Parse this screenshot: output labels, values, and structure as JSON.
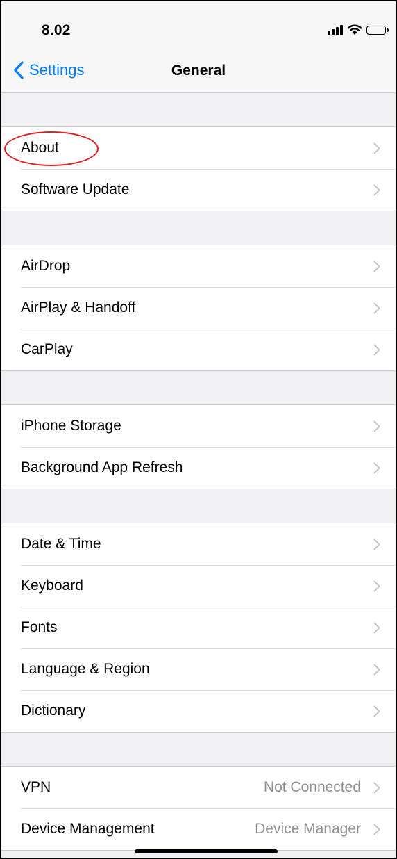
{
  "status_bar": {
    "time": "8.02"
  },
  "nav": {
    "back_label": "Settings",
    "title": "General"
  },
  "groups": [
    {
      "rows": [
        {
          "label": "About"
        },
        {
          "label": "Software Update"
        }
      ]
    },
    {
      "rows": [
        {
          "label": "AirDrop"
        },
        {
          "label": "AirPlay & Handoff"
        },
        {
          "label": "CarPlay"
        }
      ]
    },
    {
      "rows": [
        {
          "label": "iPhone Storage"
        },
        {
          "label": "Background App Refresh"
        }
      ]
    },
    {
      "rows": [
        {
          "label": "Date & Time"
        },
        {
          "label": "Keyboard"
        },
        {
          "label": "Fonts"
        },
        {
          "label": "Language & Region"
        },
        {
          "label": "Dictionary"
        }
      ]
    },
    {
      "rows": [
        {
          "label": "VPN",
          "detail": "Not Connected"
        },
        {
          "label": "Device Management",
          "detail": "Device Manager"
        }
      ]
    }
  ],
  "icons": {
    "back": "chevron-left-icon",
    "row": "chevron-right-icon",
    "signal": "cellular-signal-icon",
    "wifi": "wifi-icon",
    "battery": "battery-icon"
  },
  "colors": {
    "accent": "#007aff",
    "annotation": "#e02020",
    "background": "#efeff4",
    "detail_text": "#8e8e93"
  }
}
